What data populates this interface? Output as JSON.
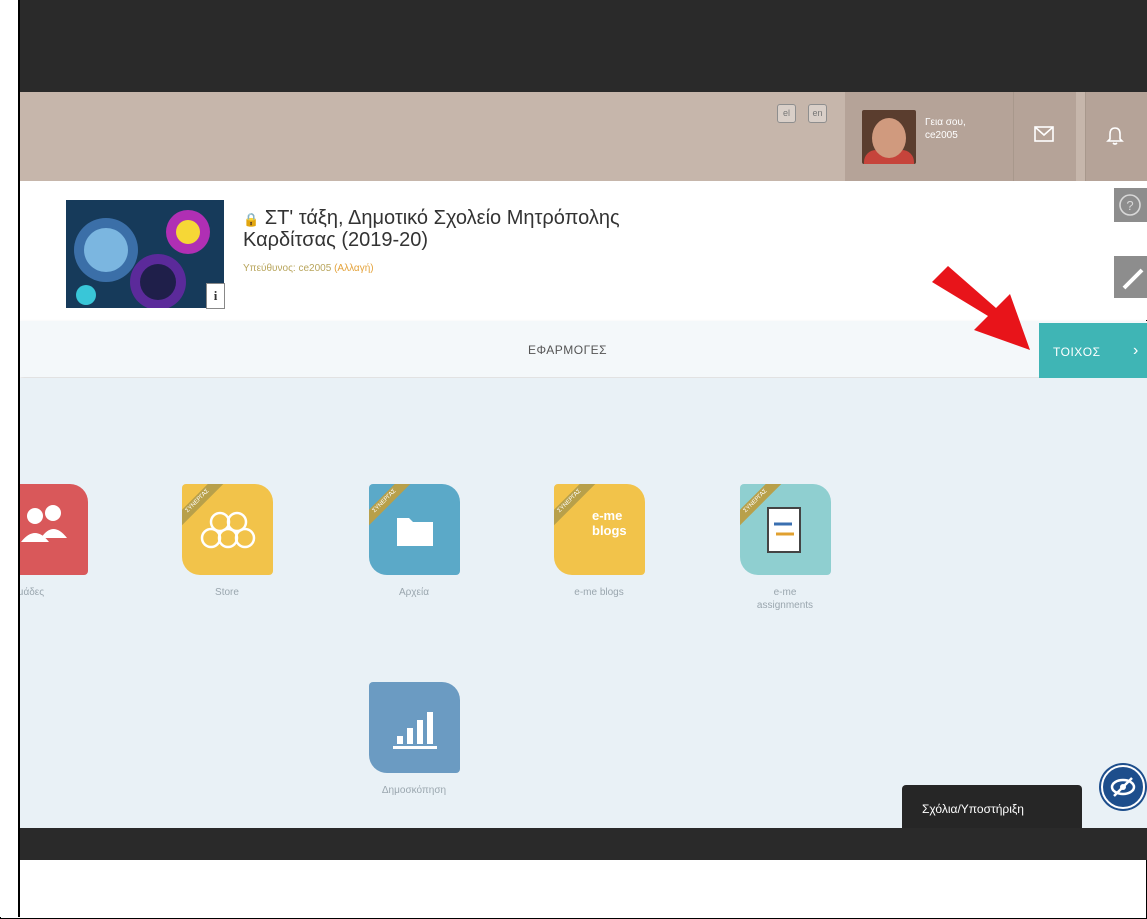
{
  "language": {
    "greek": "el",
    "english": "en"
  },
  "user": {
    "greeting_line1": "Γεια σου,",
    "greeting_line2": "ce2005"
  },
  "header": {
    "title_line1": "ΣΤ' τάξη, Δημοτικό Σχολείο Μητρόπολης",
    "title_line2": "Καρδίτσας (2019-20)",
    "owner_label": "Υπεύθυνος: ce2005",
    "change_link": "(Αλλαγή)",
    "info_badge": "i"
  },
  "tabs": {
    "apps": "ΕΦΑΡΜΟΓΕΣ",
    "wall": "ΤΟΙΧΟΣ",
    "wall_chevron": "›"
  },
  "apps": [
    {
      "label": "Ομάδες",
      "icon": "users-icon",
      "color": "#d9585a",
      "ribbon": ""
    },
    {
      "label": "Store",
      "icon": "hexagons-icon",
      "color": "#f2c34a",
      "ribbon": "ΣΥΝΕΡΓΑΣ"
    },
    {
      "label": "Αρχεία",
      "icon": "folder-icon",
      "color": "#5ba9c8",
      "ribbon": "ΣΥΝΕΡΓΑΣ"
    },
    {
      "label": "e-me blogs",
      "icon": "blogs-icon",
      "color": "#f2c34a",
      "ribbon": "ΣΥΝΕΡΓΑΣ",
      "icon_text1": "e-me",
      "icon_text2": "blogs"
    },
    {
      "label_line1": "e-me",
      "label_line2": "assignments",
      "icon": "assignment-icon",
      "color": "#8fcfd0",
      "ribbon": "ΣΥΝΕΡΓΑΣ"
    },
    {
      "label": "Δημοσκόπηση",
      "icon": "bar-chart-icon",
      "color": "#6b9bc2",
      "ribbon": ""
    }
  ],
  "support": {
    "label": "Σχόλια/Υποστήριξη"
  },
  "colors": {
    "teal": "#3fb5b5",
    "appbar": "#c6b6ab",
    "red_arrow": "#e8141a"
  }
}
